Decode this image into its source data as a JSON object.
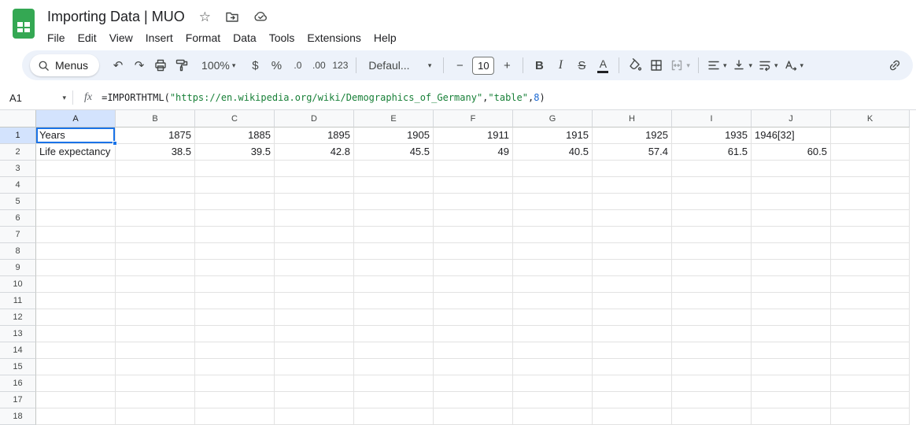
{
  "titlebar": {
    "title": "Importing Data | MUO",
    "menus": [
      "File",
      "Edit",
      "View",
      "Insert",
      "Format",
      "Data",
      "Tools",
      "Extensions",
      "Help"
    ]
  },
  "toolbar": {
    "menus_label": "Menus",
    "zoom_value": "100%",
    "font_family_value": "Defaul...",
    "font_size_value": "10"
  },
  "icons": {
    "undo": "↶",
    "redo": "↷",
    "dropdown_arrow": "▾",
    "dollar": "$",
    "percent": "%",
    "decrease_decimal": ".0",
    "increase_decimal": ".00",
    "more_formats": "123",
    "minus": "−",
    "plus": "+",
    "bold": "B",
    "italic": "I",
    "strikethrough": "S",
    "text_color": "A",
    "star": "☆"
  },
  "formula_bar": {
    "cell_ref": "A1",
    "fx_label": "fx",
    "formula": {
      "fn": "=IMPORTHTML(",
      "url": "\"https://en.wikipedia.org/wiki/Demographics_of_Germany\"",
      "comma1": ",",
      "table": "\"table\"",
      "comma2": ",",
      "index": "8",
      "close": ")"
    }
  },
  "grid": {
    "columns": [
      "A",
      "B",
      "C",
      "D",
      "E",
      "F",
      "G",
      "H",
      "I",
      "J",
      "K"
    ],
    "visible_rows": 18,
    "rows": [
      {
        "n": 1,
        "cells": [
          "Years",
          "1875",
          "1885",
          "1895",
          "1905",
          "1911",
          "1915",
          "1925",
          "1935",
          "1946[32]",
          ""
        ]
      },
      {
        "n": 2,
        "cells": [
          "Life expectancy",
          "38.5",
          "39.5",
          "42.8",
          "45.5",
          "49",
          "40.5",
          "57.4",
          "61.5",
          "60.5",
          ""
        ]
      }
    ],
    "selection": {
      "cell": "A1",
      "col": "A",
      "col_index": 0,
      "row_n": 1
    }
  },
  "colors": {
    "selection_blue": "#1a73e8",
    "toolbar_bg": "#edf2fa",
    "logo_green": "#34a853",
    "header_highlight": "#d3e3fd",
    "formula_string_green": "#188038",
    "formula_number_blue": "#1967d2"
  }
}
